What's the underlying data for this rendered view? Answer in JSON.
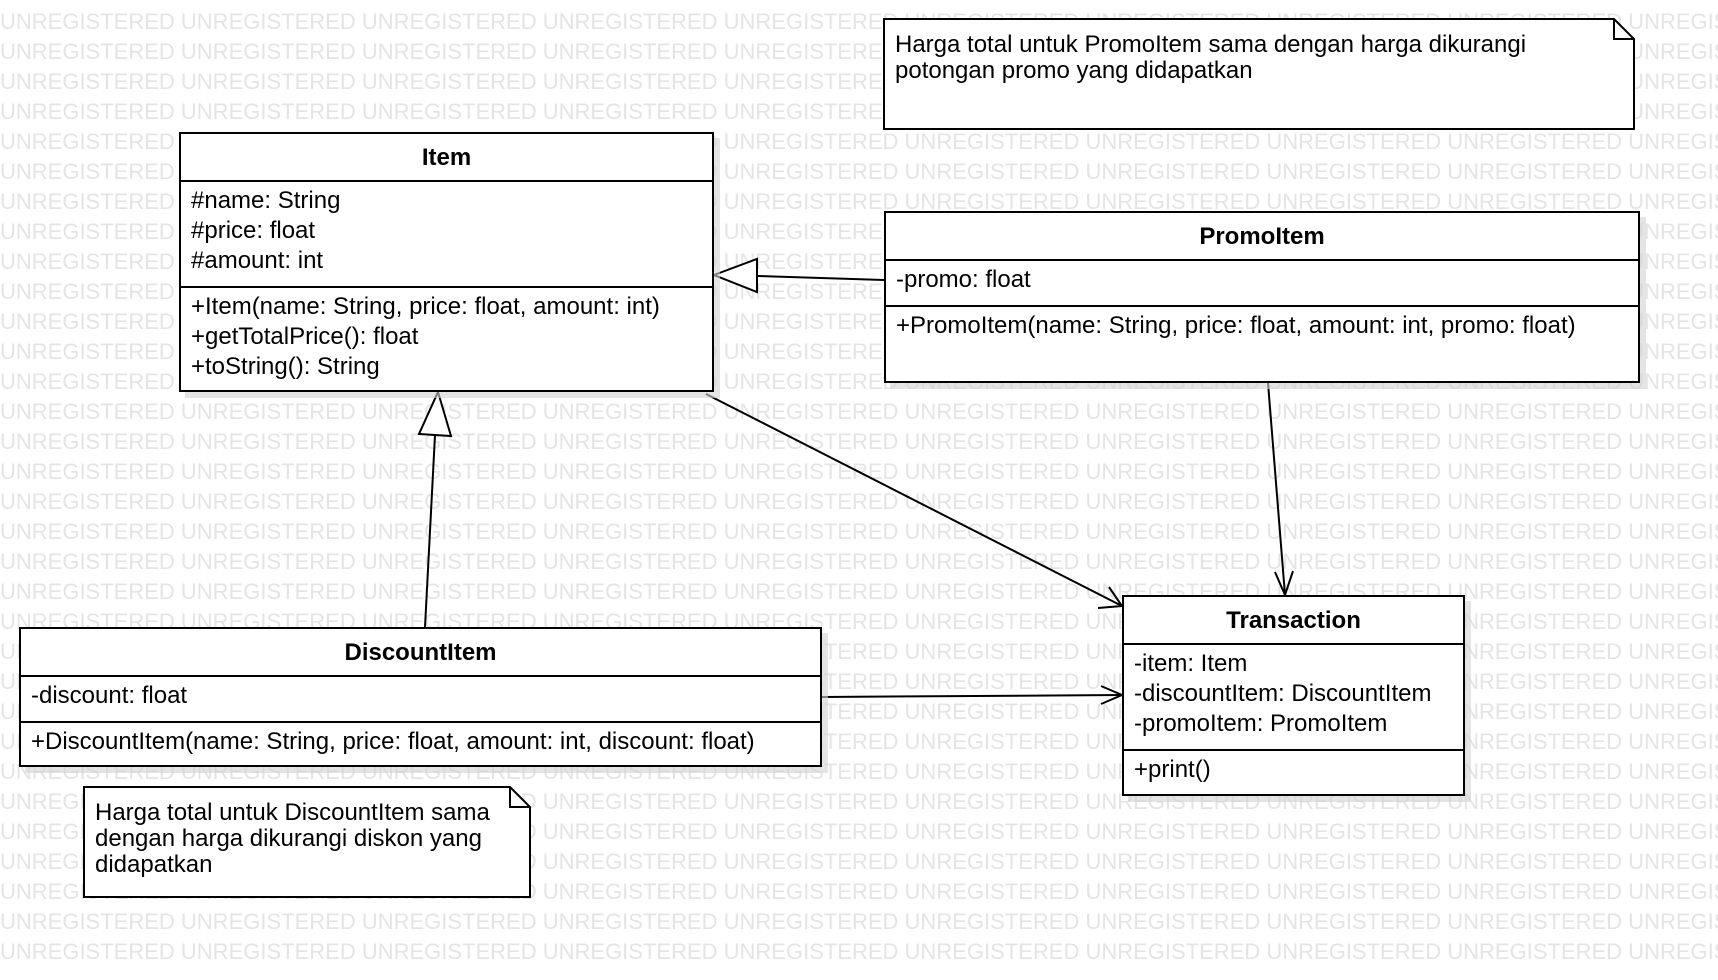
{
  "watermark": {
    "word": "UNREGISTERED",
    "rows": 32
  },
  "classes": {
    "item": {
      "name": "Item",
      "attributes": [
        "#name: String",
        "#price: float",
        "#amount: int"
      ],
      "methods": [
        "+Item(name: String, price: float, amount: int)",
        "+getTotalPrice(): float",
        "+toString(): String"
      ]
    },
    "promo_item": {
      "name": "PromoItem",
      "attributes": [
        "-promo: float"
      ],
      "methods": [
        "+PromoItem(name: String, price: float, amount: int, promo: float)"
      ]
    },
    "discount_item": {
      "name": "DiscountItem",
      "attributes": [
        "-discount: float"
      ],
      "methods": [
        "+DiscountItem(name: String, price: float, amount: int, discount: float)"
      ]
    },
    "transaction": {
      "name": "Transaction",
      "attributes": [
        "-item: Item",
        "-discountItem: DiscountItem",
        "-promoItem: PromoItem"
      ],
      "methods": [
        "+print()"
      ]
    }
  },
  "notes": {
    "promo_note": [
      "Harga total untuk PromoItem sama dengan harga dikurangi",
      "potongan promo yang didapatkan"
    ],
    "discount_note": [
      "Harga total untuk DiscountItem sama",
      "dengan harga dikurangi diskon yang",
      "didapatkan"
    ]
  }
}
